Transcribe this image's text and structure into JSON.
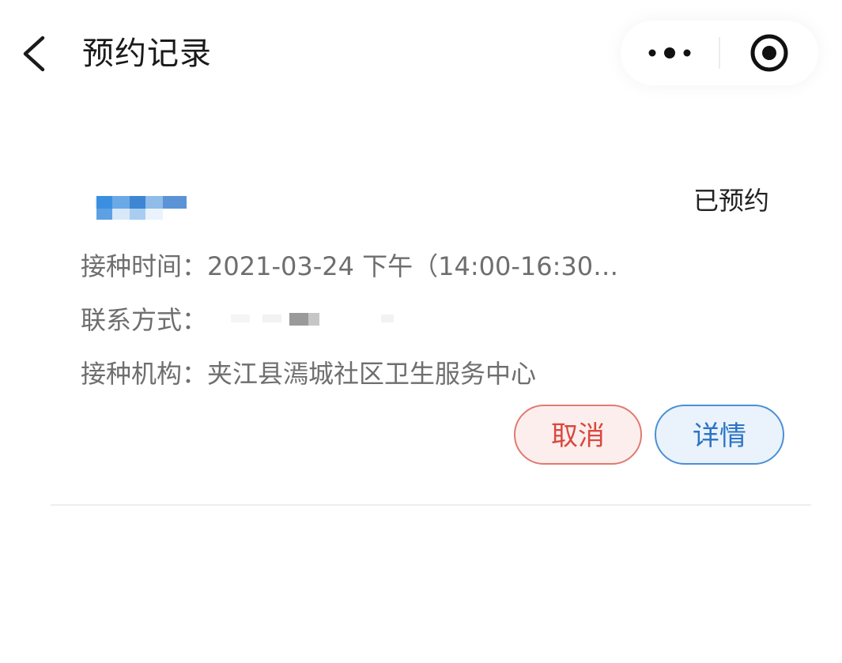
{
  "header": {
    "title": "预约记录",
    "back_icon": "chevron-left-icon",
    "more_icon": "more-dots-icon",
    "close_icon": "target-close-icon"
  },
  "record": {
    "status": "已预约",
    "time_label": "接种时间：",
    "time_value": "2021-03-24 下午（14:00-16:30…",
    "contact_label": "联系方式：",
    "org_label": "接种机构：",
    "org_value": "夹江县漹城社区卫生服务中心",
    "cancel_label": "取消",
    "detail_label": "详情"
  },
  "colors": {
    "cancel_accent": "#d9493d",
    "detail_accent": "#2b74c4"
  }
}
